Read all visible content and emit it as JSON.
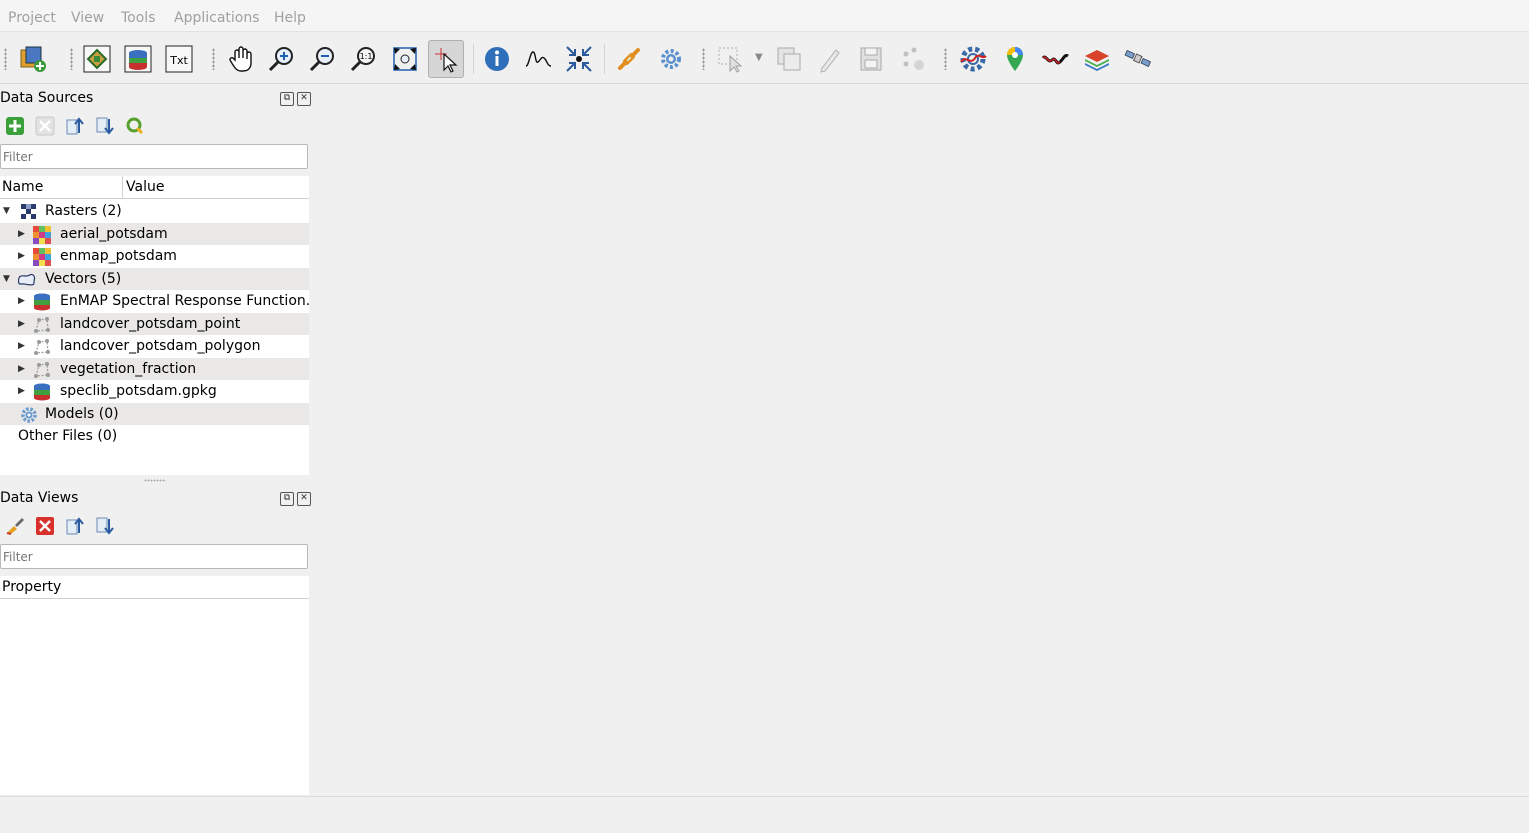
{
  "menubar": {
    "items": [
      "Project",
      "View",
      "Tools",
      "Applications",
      "Help"
    ]
  },
  "toolbar": {
    "buttons": [
      "add-data-source-icon",
      "new-map-view-icon",
      "new-spectral-library-view-icon",
      "new-text-view-icon",
      "pan-icon",
      "zoom-in-icon",
      "zoom-out-icon",
      "zoom-native-resolution-icon",
      "zoom-full-extent-icon",
      "select-map-location-icon",
      "identify-icon",
      "spectral-profile-icon",
      "move-to-center-icon",
      "link-views-icon",
      "settings-gear-icon",
      "select-features-icon",
      "delete-features-icon",
      "edit-pencil-icon",
      "save-edits-icon",
      "add-feature-icon",
      "processing-toolbox-icon",
      "location-browser-icon",
      "spectral-profile-source-icon",
      "layers-icon",
      "satellite-icon"
    ]
  },
  "data_sources": {
    "title": "Data Sources",
    "filter_placeholder": "Filter",
    "columns": {
      "name": "Name",
      "value": "Value"
    },
    "rasters": {
      "label": "Rasters (2)",
      "items": [
        "aerial_potsdam",
        "enmap_potsdam"
      ]
    },
    "vectors": {
      "label": "Vectors (5)",
      "items": [
        "EnMAP Spectral Response Function...",
        "landcover_potsdam_point",
        "landcover_potsdam_polygon",
        "vegetation_fraction",
        "speclib_potsdam.gpkg"
      ]
    },
    "models_label": "Models (0)",
    "other_files_label": "Other Files (0)"
  },
  "data_views": {
    "title": "Data Views",
    "filter_placeholder": "Filter",
    "property_header": "Property"
  },
  "colors": {
    "panel_bg": "#ffffff",
    "alt_row": "#e9e8e6",
    "window_bg": "#f0f0f0"
  }
}
